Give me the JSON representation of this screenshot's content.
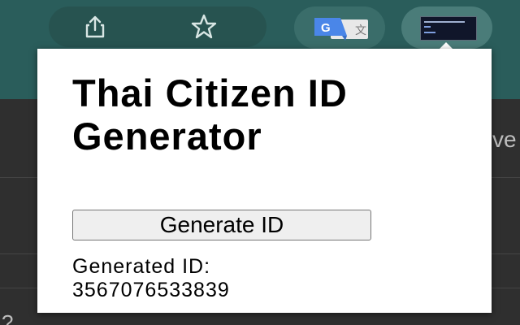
{
  "toolbar": {
    "icons": [
      "share-icon",
      "bookmark-star-icon",
      "google-translate-icon",
      "extension-thumbnail-icon"
    ],
    "accent_color": "#2a5d5b"
  },
  "page": {
    "side_text": "ve",
    "bottom_text": "?"
  },
  "popup": {
    "title": "Thai Citizen ID Generator",
    "generate_button_label": "Generate ID",
    "result_label": "Generated ID:",
    "result_value": "3567076533839"
  }
}
